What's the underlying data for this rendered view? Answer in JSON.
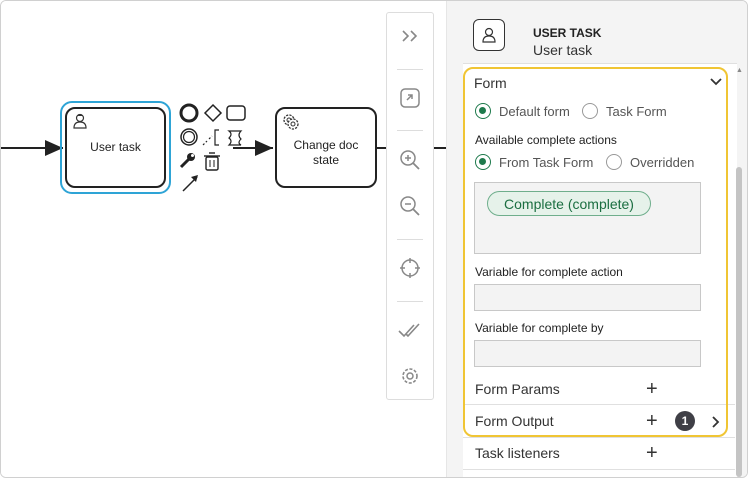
{
  "diagram": {
    "user_task": {
      "label": "User task"
    },
    "change_doc_task": {
      "label": "Change doc state"
    }
  },
  "toolbar": {
    "items": [
      "collapse-panel-icon",
      "fit-to-view-icon",
      "zoom-in-icon",
      "zoom-out-icon",
      "center-icon",
      "validate-icon",
      "settings-icon"
    ]
  },
  "panel": {
    "header": {
      "type": "USER TASK",
      "name": "User task"
    },
    "form": {
      "title": "Form",
      "form_type": {
        "options": [
          "Default form",
          "Task Form"
        ],
        "selected": "Default form"
      },
      "complete_actions": {
        "label": "Available complete actions",
        "options": [
          "From Task Form",
          "Overridden"
        ],
        "selected": "From Task Form",
        "items": [
          "Complete (complete)"
        ]
      },
      "variable_action": {
        "label": "Variable for complete action",
        "value": ""
      },
      "variable_by": {
        "label": "Variable for complete by",
        "value": ""
      },
      "form_params": {
        "label": "Form Params"
      },
      "form_output": {
        "label": "Form Output",
        "count": "1"
      }
    },
    "task_listeners": {
      "label": "Task listeners"
    }
  },
  "colors": {
    "selection": "#2ea4d6",
    "highlight": "#f0c534",
    "accent": "#1e7a4c"
  }
}
